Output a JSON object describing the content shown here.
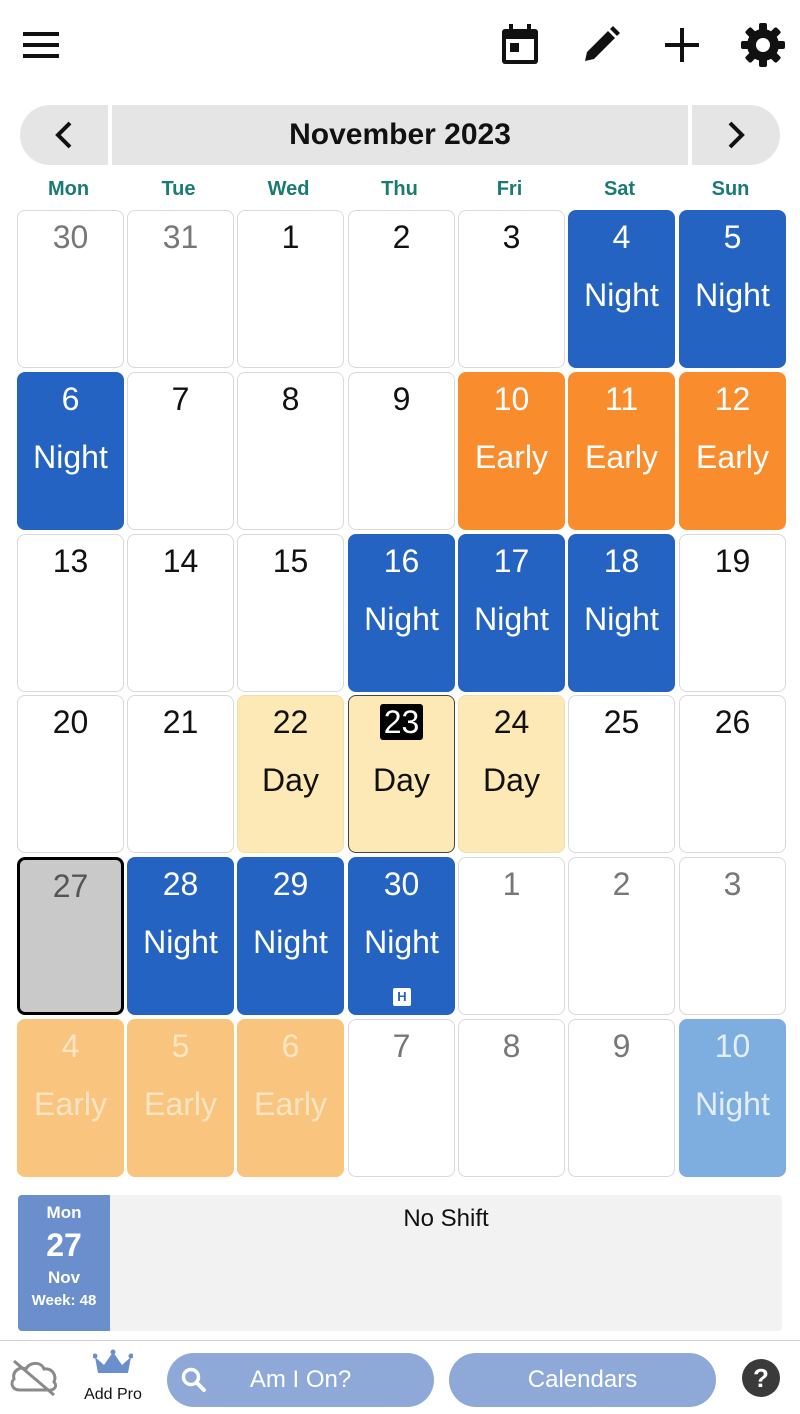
{
  "header": {
    "month_title": "November 2023"
  },
  "weekdays": [
    "Mon",
    "Tue",
    "Wed",
    "Thu",
    "Fri",
    "Sat",
    "Sun"
  ],
  "calendar": {
    "cells": [
      {
        "day": "30",
        "shift": "",
        "kind": "other"
      },
      {
        "day": "31",
        "shift": "",
        "kind": "other"
      },
      {
        "day": "1",
        "shift": "",
        "kind": "plain"
      },
      {
        "day": "2",
        "shift": "",
        "kind": "plain"
      },
      {
        "day": "3",
        "shift": "",
        "kind": "plain"
      },
      {
        "day": "4",
        "shift": "Night",
        "kind": "night"
      },
      {
        "day": "5",
        "shift": "Night",
        "kind": "night"
      },
      {
        "day": "6",
        "shift": "Night",
        "kind": "night"
      },
      {
        "day": "7",
        "shift": "",
        "kind": "plain"
      },
      {
        "day": "8",
        "shift": "",
        "kind": "plain"
      },
      {
        "day": "9",
        "shift": "",
        "kind": "plain"
      },
      {
        "day": "10",
        "shift": "Early",
        "kind": "early"
      },
      {
        "day": "11",
        "shift": "Early",
        "kind": "early"
      },
      {
        "day": "12",
        "shift": "Early",
        "kind": "early"
      },
      {
        "day": "13",
        "shift": "",
        "kind": "plain"
      },
      {
        "day": "14",
        "shift": "",
        "kind": "plain"
      },
      {
        "day": "15",
        "shift": "",
        "kind": "plain"
      },
      {
        "day": "16",
        "shift": "Night",
        "kind": "night"
      },
      {
        "day": "17",
        "shift": "Night",
        "kind": "night"
      },
      {
        "day": "18",
        "shift": "Night",
        "kind": "night"
      },
      {
        "day": "19",
        "shift": "",
        "kind": "plain"
      },
      {
        "day": "20",
        "shift": "",
        "kind": "plain"
      },
      {
        "day": "21",
        "shift": "",
        "kind": "plain"
      },
      {
        "day": "22",
        "shift": "Day",
        "kind": "day"
      },
      {
        "day": "23",
        "shift": "Day",
        "kind": "day today"
      },
      {
        "day": "24",
        "shift": "Day",
        "kind": "day"
      },
      {
        "day": "25",
        "shift": "",
        "kind": "plain"
      },
      {
        "day": "26",
        "shift": "",
        "kind": "plain"
      },
      {
        "day": "27",
        "shift": "",
        "kind": "selected"
      },
      {
        "day": "28",
        "shift": "Night",
        "kind": "night"
      },
      {
        "day": "29",
        "shift": "Night",
        "kind": "night"
      },
      {
        "day": "30",
        "shift": "Night",
        "kind": "night",
        "badge": "H"
      },
      {
        "day": "1",
        "shift": "",
        "kind": "other"
      },
      {
        "day": "2",
        "shift": "",
        "kind": "other"
      },
      {
        "day": "3",
        "shift": "",
        "kind": "other"
      },
      {
        "day": "4",
        "shift": "Early",
        "kind": "early faded"
      },
      {
        "day": "5",
        "shift": "Early",
        "kind": "early faded"
      },
      {
        "day": "6",
        "shift": "Early",
        "kind": "early faded"
      },
      {
        "day": "7",
        "shift": "",
        "kind": "other"
      },
      {
        "day": "8",
        "shift": "",
        "kind": "other"
      },
      {
        "day": "9",
        "shift": "",
        "kind": "other"
      },
      {
        "day": "10",
        "shift": "Night",
        "kind": "night faded"
      }
    ]
  },
  "detail": {
    "weekday": "Mon",
    "day": "27",
    "month": "Nov",
    "week": "Week: 48",
    "status": "No Shift"
  },
  "bottom": {
    "pro_label": "Add Pro",
    "search_label": "Am I On?",
    "calendars_label": "Calendars",
    "help_label": "?"
  },
  "colors": {
    "night": "#2563c2",
    "early": "#f98d2d",
    "day": "#fde9b5",
    "weekday_header": "#1a7a74",
    "pill": "#8ea9d8"
  }
}
